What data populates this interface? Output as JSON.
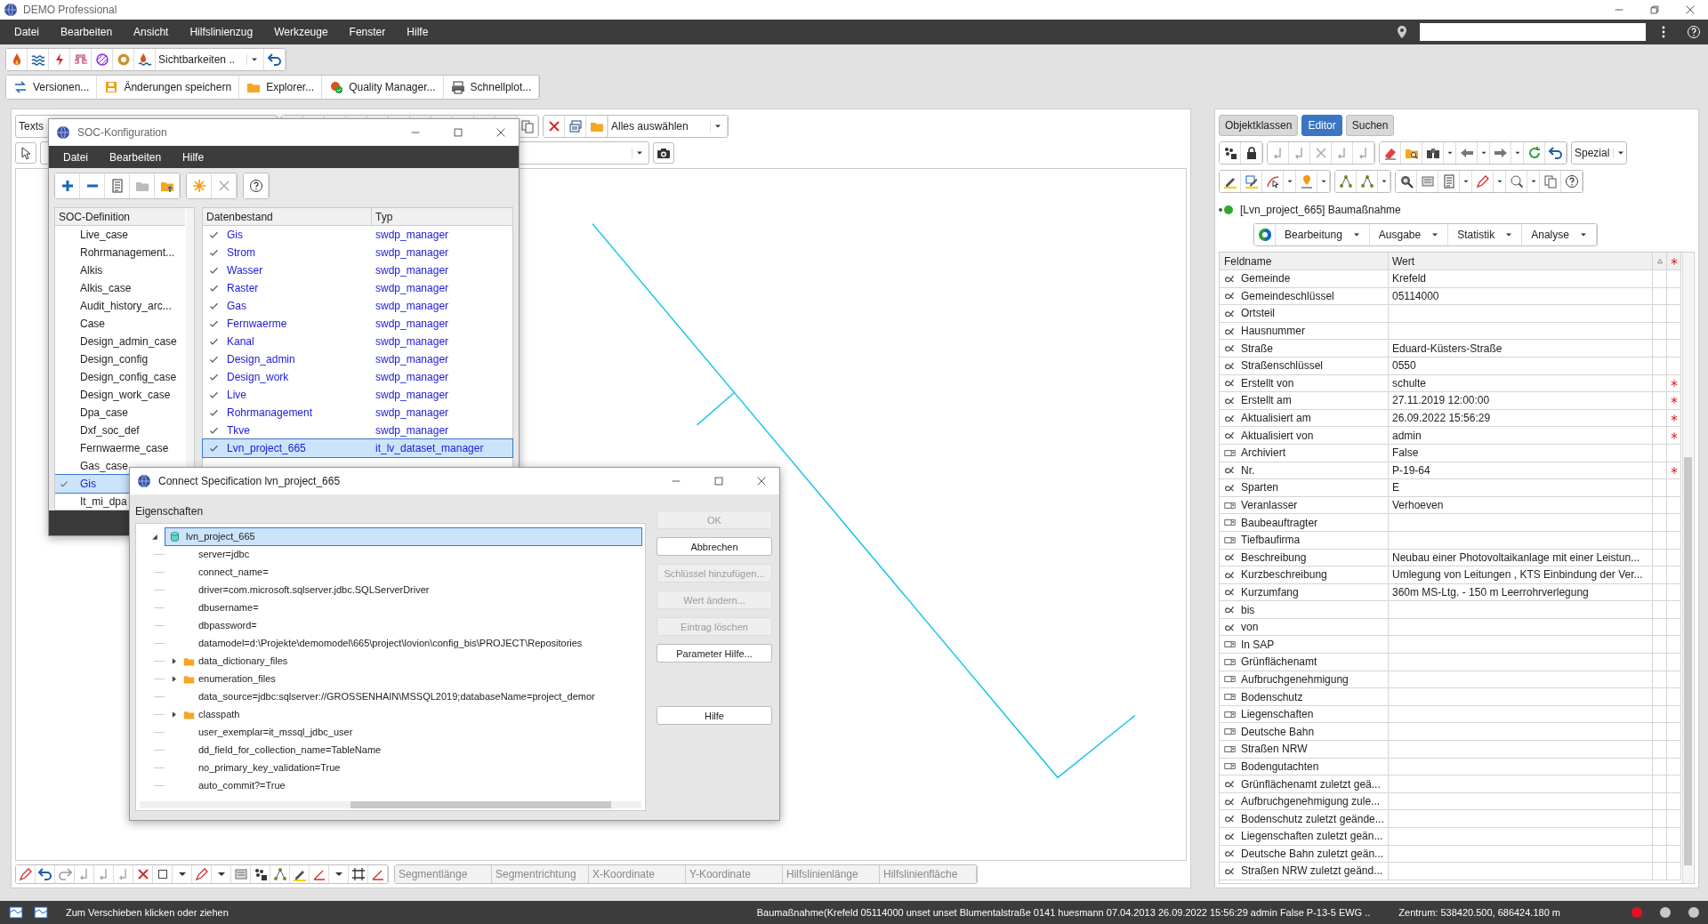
{
  "window": {
    "title": "DEMO Professional"
  },
  "menu": [
    "Datei",
    "Bearbeiten",
    "Ansicht",
    "Hilfslinienzug",
    "Werkzeuge",
    "Fenster",
    "Hilfe"
  ],
  "visibility_combo": {
    "value": "Sichtbarkeiten .."
  },
  "main_toolbar": [
    {
      "label": "Versionen...",
      "kind": "versions"
    },
    {
      "label": "Änderungen speichern",
      "kind": "save"
    },
    {
      "label": "Explorer...",
      "kind": "explorer"
    },
    {
      "label": "Quality Manager...",
      "kind": "quality"
    },
    {
      "label": "Schnellplot...",
      "kind": "plot"
    }
  ],
  "canvas_toolbar": {
    "text_combo": "Texts",
    "select_combo": "Alles auswählen"
  },
  "soc_dialog": {
    "title": "SOC-Konfiguration",
    "menu": [
      "Datei",
      "Bearbeiten",
      "Hilfe"
    ],
    "definitions_header": "SOC-Definition",
    "definitions": [
      {
        "label": "Live_case",
        "selected": false
      },
      {
        "label": "Rohrmanagement...",
        "selected": false
      },
      {
        "label": "Alkis",
        "selected": false
      },
      {
        "label": "Alkis_case",
        "selected": false
      },
      {
        "label": "Audit_history_arc...",
        "selected": false
      },
      {
        "label": "Case",
        "selected": false
      },
      {
        "label": "Design_admin_case",
        "selected": false
      },
      {
        "label": "Design_config",
        "selected": false
      },
      {
        "label": "Design_config_case",
        "selected": false
      },
      {
        "label": "Design_work_case",
        "selected": false
      },
      {
        "label": "Dpa_case",
        "selected": false
      },
      {
        "label": "Dxf_soc_def",
        "selected": false
      },
      {
        "label": "Fernwaerme_case",
        "selected": false
      },
      {
        "label": "Gas_case",
        "selected": false
      },
      {
        "label": "Gis",
        "selected": true
      },
      {
        "label": "It_mi_dpa",
        "selected": false
      }
    ],
    "columns": [
      "Datenbestand",
      "Typ"
    ],
    "datasets": [
      {
        "name": "Gis",
        "type": "swdp_manager",
        "checked": true,
        "selected": false
      },
      {
        "name": "Strom",
        "type": "swdp_manager",
        "checked": true,
        "selected": false
      },
      {
        "name": "Wasser",
        "type": "swdp_manager",
        "checked": true,
        "selected": false
      },
      {
        "name": "Raster",
        "type": "swdp_manager",
        "checked": true,
        "selected": false
      },
      {
        "name": "Gas",
        "type": "swdp_manager",
        "checked": true,
        "selected": false
      },
      {
        "name": "Fernwaerme",
        "type": "swdp_manager",
        "checked": true,
        "selected": false
      },
      {
        "name": "Kanal",
        "type": "swdp_manager",
        "checked": true,
        "selected": false
      },
      {
        "name": "Design_admin",
        "type": "swdp_manager",
        "checked": true,
        "selected": false
      },
      {
        "name": "Design_work",
        "type": "swdp_manager",
        "checked": true,
        "selected": false
      },
      {
        "name": "Live",
        "type": "swdp_manager",
        "checked": true,
        "selected": false
      },
      {
        "name": "Rohrmanagement",
        "type": "swdp_manager",
        "checked": true,
        "selected": false
      },
      {
        "name": "Tkve",
        "type": "swdp_manager",
        "checked": true,
        "selected": false
      },
      {
        "name": "Lvn_project_665",
        "type": "it_lv_dataset_manager",
        "checked": true,
        "selected": true
      }
    ]
  },
  "connect_dialog": {
    "title": "Connect Specification lvn_project_665",
    "section": "Eigenschaften",
    "tree": {
      "label": "lvn_project_665",
      "expanded": true,
      "selected": true,
      "children": [
        {
          "label": "server=jdbc",
          "kind": "entry"
        },
        {
          "label": "connect_name=",
          "kind": "entry"
        },
        {
          "label": "driver=com.microsoft.sqlserver.jdbc.SQLServerDriver",
          "kind": "entry"
        },
        {
          "label": "dbusername=",
          "kind": "entry"
        },
        {
          "label": "dbpassword=",
          "kind": "entry"
        },
        {
          "label": "datamodel=d:\\Projekte\\demomodel\\665\\project\\lovion\\config_bis\\PROJECT\\Repositories",
          "kind": "entry"
        },
        {
          "label": "data_dictionary_files",
          "kind": "folder",
          "expanded": false
        },
        {
          "label": "enumeration_files",
          "kind": "folder",
          "expanded": false
        },
        {
          "label": "data_source=jdbc:sqlserver://GROSSENHAIN\\MSSQL2019;databaseName=project_demor",
          "kind": "entry"
        },
        {
          "label": "classpath",
          "kind": "folder",
          "expanded": false
        },
        {
          "label": "user_exemplar=it_mssql_jdbc_user",
          "kind": "entry"
        },
        {
          "label": "dd_field_for_collection_name=TableName",
          "kind": "entry"
        },
        {
          "label": "no_primary_key_validation=True",
          "kind": "entry"
        },
        {
          "label": "auto_commit?=True",
          "kind": "entry"
        }
      ]
    },
    "buttons": [
      {
        "label": "OK",
        "disabled": true
      },
      {
        "label": "Abbrechen",
        "disabled": false
      },
      {
        "label": "Schlüssel hinzufügen...",
        "disabled": true
      },
      {
        "label": "Wert ändern...",
        "disabled": true
      },
      {
        "label": "Eintrag löschen",
        "disabled": true
      },
      {
        "label": "Parameter Hilfe...",
        "disabled": false
      },
      {
        "label": "Hilfe",
        "disabled": false
      }
    ]
  },
  "right_panel": {
    "tabs": [
      {
        "label": "Objektklassen",
        "selected": false
      },
      {
        "label": "Editor",
        "selected": true
      },
      {
        "label": "Suchen",
        "selected": false
      }
    ],
    "special_combo": "Spezial",
    "record_title": "[Lvn_project_665] Baumaßnahme",
    "menus": [
      "Bearbeitung",
      "Ausgabe",
      "Statistik",
      "Analyse"
    ],
    "columns": [
      "Feldname",
      "Wert"
    ],
    "rows": [
      {
        "field": "Gemeinde",
        "value": "Krefeld",
        "kind": "text",
        "required": false
      },
      {
        "field": "Gemeindeschlüssel",
        "value": "05114000",
        "kind": "text",
        "required": false
      },
      {
        "field": "Ortsteil",
        "kind": "text",
        "required": false
      },
      {
        "field": "Hausnummer",
        "kind": "text",
        "required": false
      },
      {
        "field": "Straße",
        "value": "Eduard-Küsters-Straße",
        "kind": "text",
        "required": false
      },
      {
        "field": "Straßenschlüssel",
        "value": "0550",
        "kind": "text",
        "required": false
      },
      {
        "field": "Erstellt von",
        "value": "schulte",
        "kind": "text",
        "required": true
      },
      {
        "field": "Erstellt am",
        "value": "27.11.2019 12:00:00",
        "kind": "text",
        "required": true
      },
      {
        "field": "Aktualisiert am",
        "value": "26.09.2022 15:56:29",
        "kind": "text",
        "required": true
      },
      {
        "field": "Aktualisiert von",
        "value": "admin",
        "kind": "text",
        "required": true
      },
      {
        "field": "Archiviert",
        "value": "False",
        "kind": "choice",
        "required": false
      },
      {
        "field": "Nr.",
        "value": "P-19-64",
        "kind": "text",
        "required": true
      },
      {
        "field": "Sparten",
        "value": "E",
        "kind": "text",
        "required": false
      },
      {
        "field": "Veranlasser",
        "value": "Verhoeven",
        "kind": "choice",
        "required": false
      },
      {
        "field": "Baubeauftragter",
        "kind": "choice",
        "required": false
      },
      {
        "field": "Tiefbaufirma",
        "kind": "choice",
        "required": false
      },
      {
        "field": "Beschreibung",
        "value": "Neubau einer Photovoltaikanlage mit einer Leistun...",
        "kind": "text",
        "required": false
      },
      {
        "field": "Kurzbeschreibung",
        "value": "Umlegung von Leitungen , KTS Einbindung der Ver...",
        "kind": "text",
        "required": false
      },
      {
        "field": "Kurzumfang",
        "value": "360m MS-Ltg. - 150 m Leerrohrverlegung",
        "kind": "text",
        "required": false
      },
      {
        "field": "bis",
        "kind": "text",
        "required": false
      },
      {
        "field": "von",
        "kind": "text",
        "required": false
      },
      {
        "field": "In SAP",
        "kind": "choice",
        "required": false
      },
      {
        "field": "Grünflächenamt",
        "kind": "choice",
        "required": false
      },
      {
        "field": "Aufbruchgenehmigung",
        "kind": "choice",
        "required": false
      },
      {
        "field": "Bodenschutz",
        "kind": "choice",
        "required": false
      },
      {
        "field": "Liegenschaften",
        "kind": "choice",
        "required": false
      },
      {
        "field": "Deutsche Bahn",
        "kind": "choice",
        "required": false
      },
      {
        "field": "Straßen NRW",
        "kind": "choice",
        "required": false
      },
      {
        "field": "Bodengutachten",
        "kind": "choice",
        "required": false
      },
      {
        "field": "Grünflächenamt zuletzt geä...",
        "kind": "text",
        "required": false
      },
      {
        "field": "Aufbruchgenehmigung zule...",
        "kind": "text",
        "required": false
      },
      {
        "field": "Bodenschutz zuletzt geände...",
        "kind": "text",
        "required": false
      },
      {
        "field": "Liegenschaften zuletzt geän...",
        "kind": "text",
        "required": false
      },
      {
        "field": "Deutsche Bahn zuletzt geän...",
        "kind": "text",
        "required": false
      },
      {
        "field": "Straßen NRW zuletzt geänd...",
        "kind": "text",
        "required": false
      }
    ]
  },
  "measure_fields": [
    {
      "placeholder": "Segmentlänge"
    },
    {
      "placeholder": "Segmentrichtung"
    },
    {
      "placeholder": "X-Koordinate"
    },
    {
      "placeholder": "Y-Koordinate"
    },
    {
      "placeholder": "Hilfslinienlänge"
    },
    {
      "placeholder": "Hilfslinienfläche"
    }
  ],
  "status_bar": {
    "hint": "Zum Verschieben klicken oder ziehen",
    "record": "Baumaßnahme(Krefeld 05114000 unset unset Blumentalstraße 0141 huesmann 07.04.2013 26.09.2022 15:56:29 admin False P-13-5 EWG ..",
    "center": "Zentrum: 538420.500, 686424.180 m",
    "indicators": [
      {
        "color": "#e81123"
      },
      {
        "color": "#c8c8c8"
      },
      {
        "color": "#c8c8c8"
      }
    ]
  }
}
